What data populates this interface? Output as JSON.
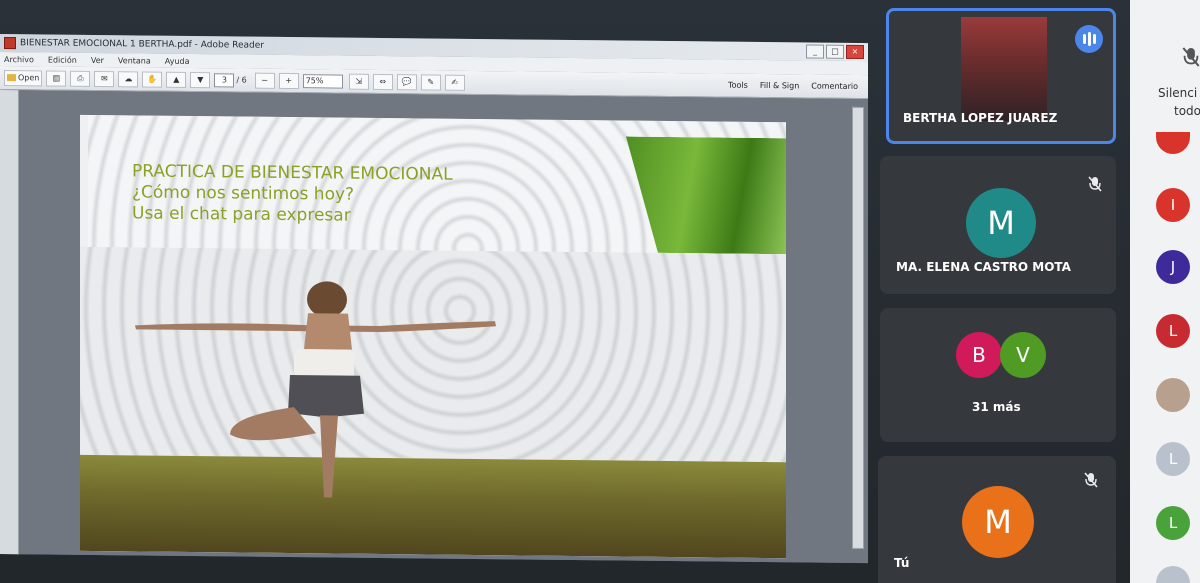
{
  "reader": {
    "title": "BIENESTAR EMOCIONAL 1 BERTHA.pdf - Adobe Reader",
    "menu": [
      "Archivo",
      "Edición",
      "Ver",
      "Ventana",
      "Ayuda"
    ],
    "toolbar": {
      "open_label": "Open",
      "page_current": "3",
      "page_total": "/ 6",
      "zoom": "75%",
      "right_items": [
        "Tools",
        "Fill & Sign",
        "Comentario"
      ]
    }
  },
  "slide": {
    "title_lines": [
      "PRACTICA DE BIENESTAR EMOCIONAL",
      "¿Cómo nos sentimos hoy?",
      "Usa el chat para expresar"
    ],
    "title_color": "#8aa128",
    "banner_color": "#5a9a2a"
  },
  "meet": {
    "tiles": [
      {
        "name": "BERTHA LOPEZ JUAREZ",
        "speaking": true
      },
      {
        "name": "MA. ELENA CASTRO MOTA",
        "initial": "M",
        "color": "#1f8a87",
        "muted": true
      },
      {
        "group": [
          {
            "initial": "B",
            "color": "#d01a5a"
          },
          {
            "initial": "V",
            "color": "#4f9b23"
          }
        ],
        "more": "31 más"
      },
      {
        "name": "Tú",
        "initial": "M",
        "color": "#e8711a",
        "muted": true
      }
    ],
    "side_panel": {
      "text_lines": [
        "Silenci",
        "todo"
      ],
      "avatars": [
        {
          "initial": "I",
          "color": "#d9342b"
        },
        {
          "initial": "J",
          "color": "#3f2a9c"
        },
        {
          "initial": "L",
          "color": "#c82a32"
        },
        {
          "initial": "",
          "color": "#b8a08e"
        },
        {
          "initial": "L",
          "color": "#b9c2cc"
        },
        {
          "initial": "L",
          "color": "#4aa33a"
        }
      ]
    }
  },
  "colors": {
    "accent": "#4b86e8",
    "tile_bg": "#35393d"
  }
}
